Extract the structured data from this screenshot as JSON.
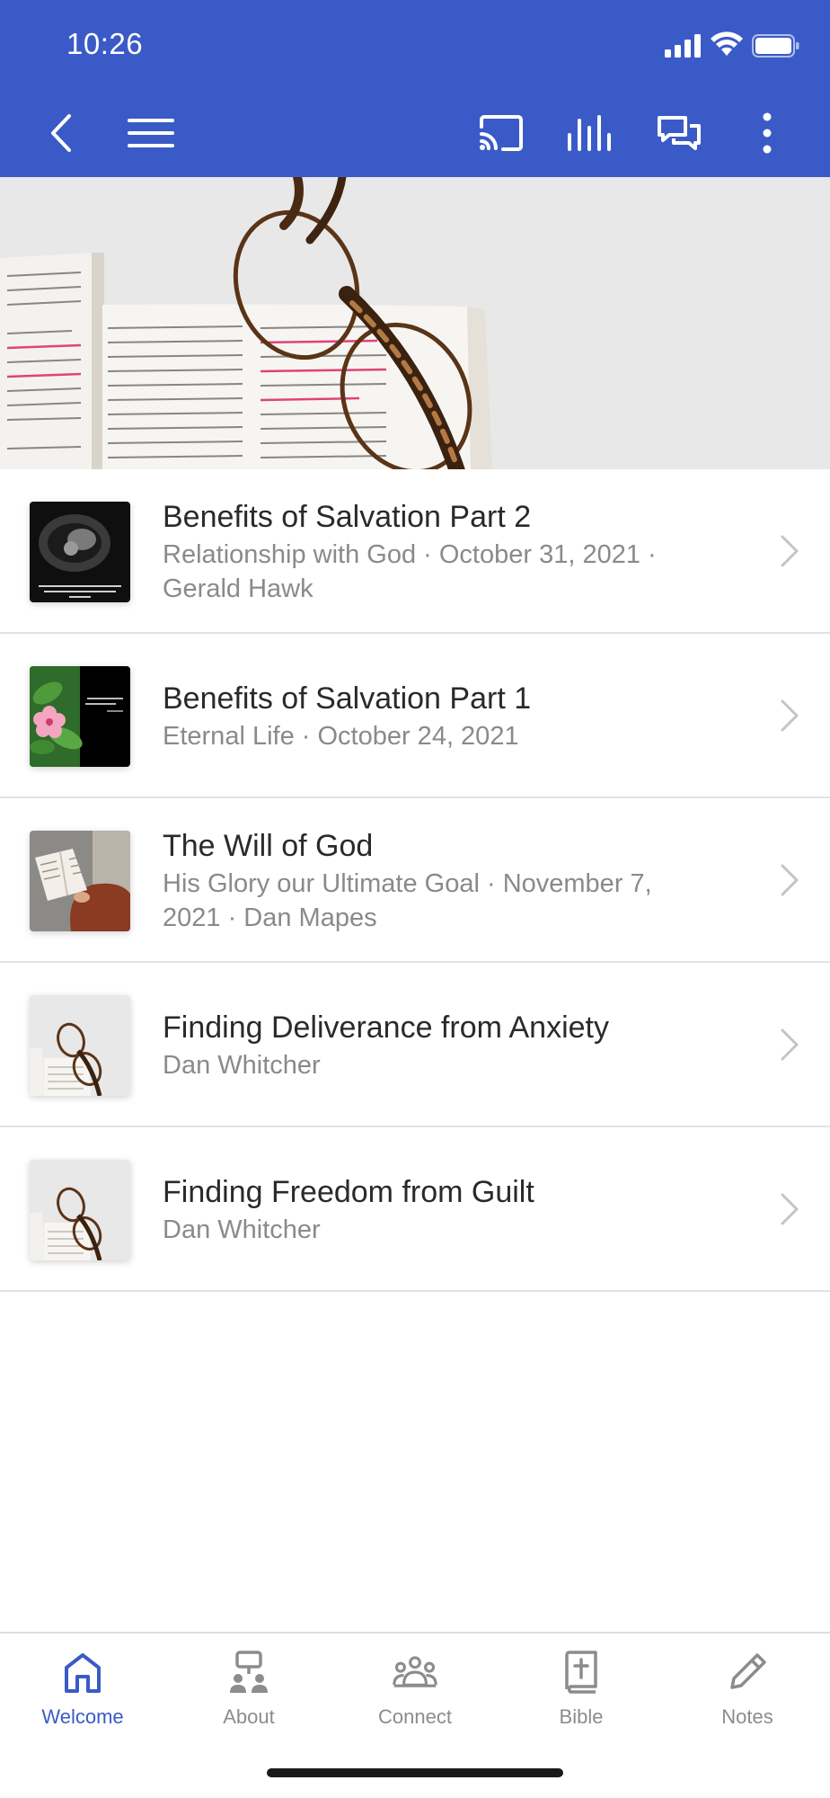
{
  "status_bar": {
    "time": "10:26"
  },
  "header": {
    "icons": [
      "back-icon",
      "menu-icon",
      "cast-icon",
      "audio-icon",
      "chat-icon",
      "more-icon"
    ],
    "color": "#3a5bc7"
  },
  "hero": {
    "image": "open-bible-with-glasses"
  },
  "messages": [
    {
      "title": "Benefits of Salvation Part 2",
      "subtitle": "Relationship with God · October 31, 2021 ·",
      "subtitle2": "Gerald Hawk",
      "thumb": "ultrasound-verse"
    },
    {
      "title": "Benefits of Salvation Part 1",
      "subtitle": "Eternal Life · October 24, 2021",
      "subtitle2": "",
      "thumb": "flower-verse"
    },
    {
      "title": "The Will of God",
      "subtitle": "His Glory our Ultimate Goal · November 7,",
      "subtitle2": "2021 · Dan Mapes",
      "thumb": "person-reading"
    },
    {
      "title": "Finding Deliverance from Anxiety",
      "subtitle": "Dan Whitcher",
      "subtitle2": "",
      "thumb": "bible-glasses"
    },
    {
      "title": "Finding Freedom from Guilt",
      "subtitle": "Dan Whitcher",
      "subtitle2": "",
      "thumb": "bible-glasses"
    }
  ],
  "tabbar": {
    "active_color": "#3a5bc7",
    "tabs": [
      {
        "label": "Welcome",
        "icon": "home-icon",
        "active": true
      },
      {
        "label": "About",
        "icon": "about-icon",
        "active": false
      },
      {
        "label": "Connect",
        "icon": "group-icon",
        "active": false
      },
      {
        "label": "Bible",
        "icon": "bible-icon",
        "active": false
      },
      {
        "label": "Notes",
        "icon": "pencil-icon",
        "active": false
      }
    ]
  }
}
